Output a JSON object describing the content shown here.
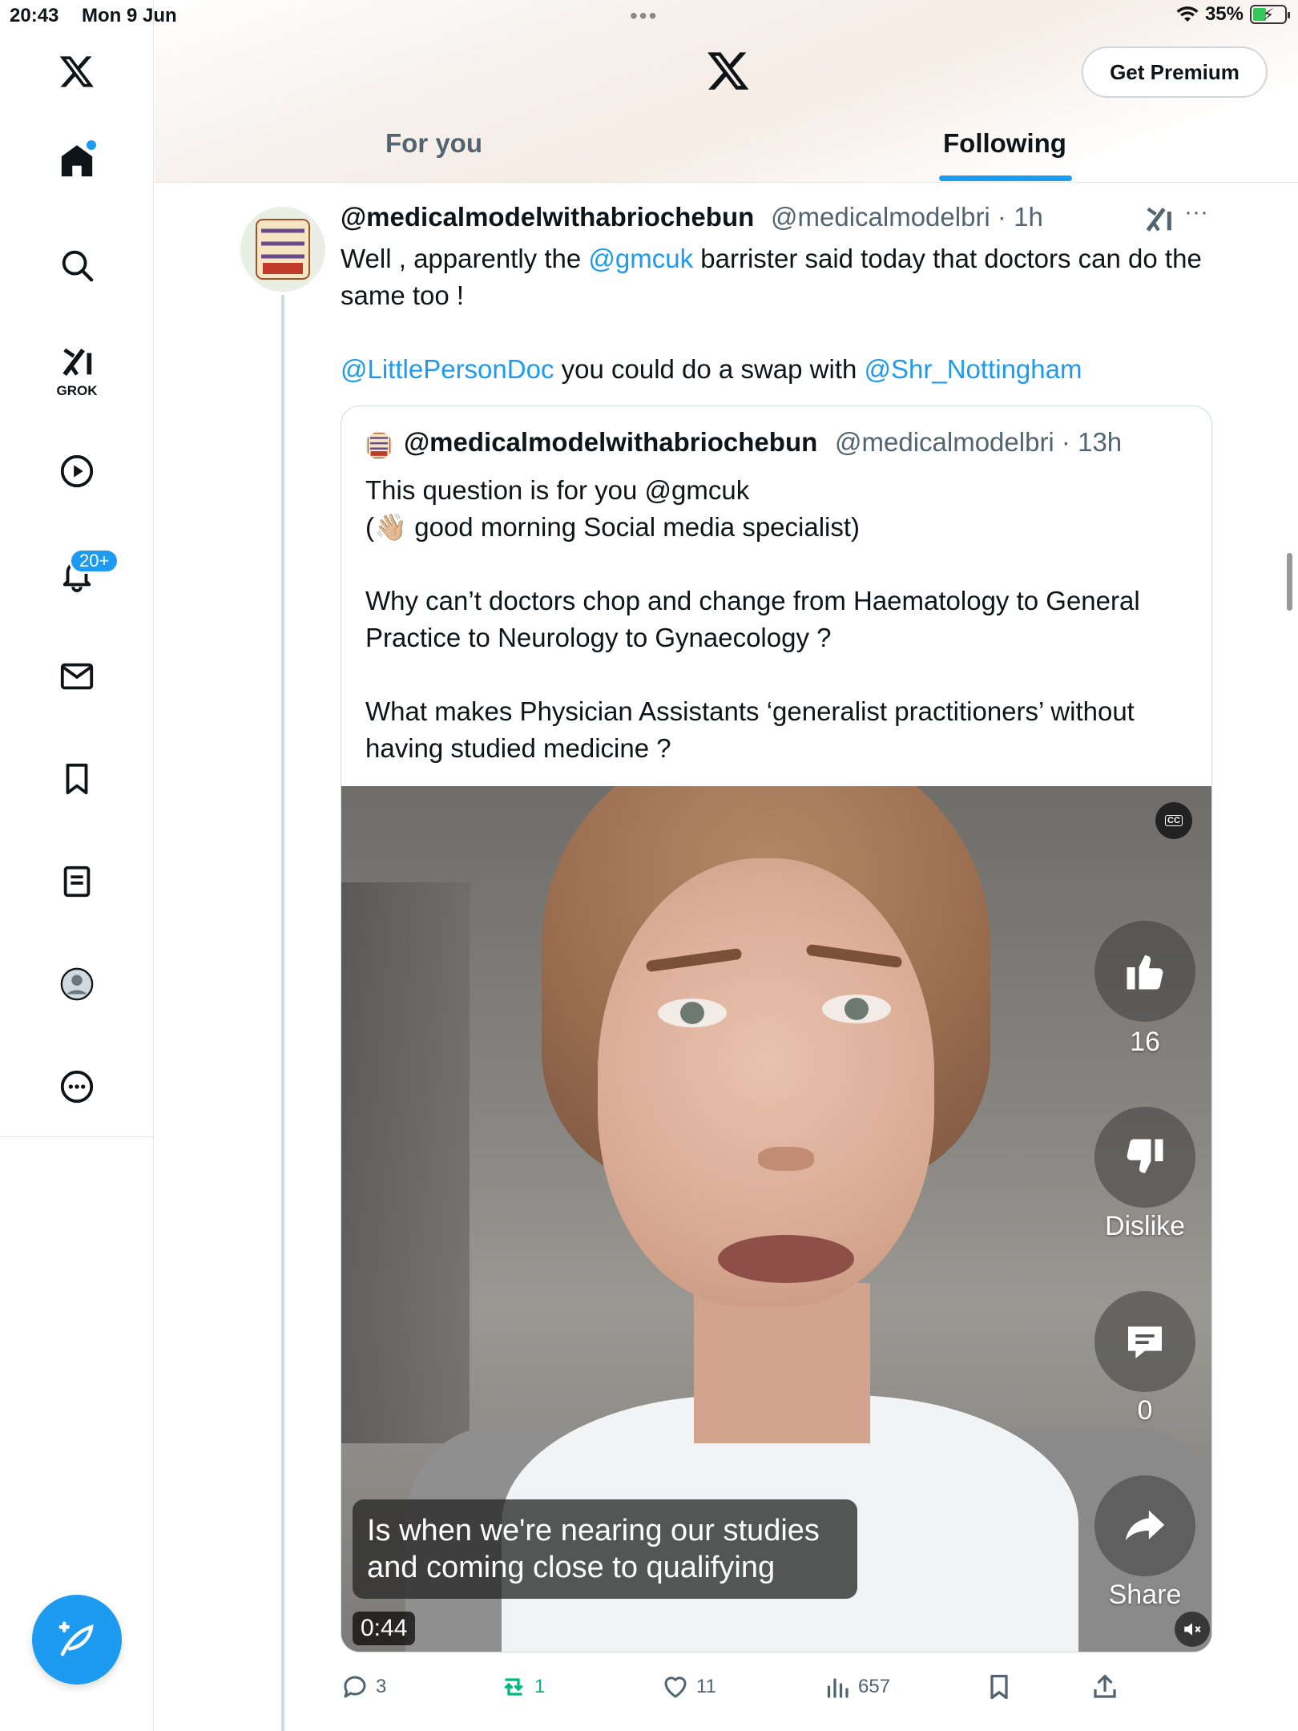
{
  "status_bar": {
    "time": "20:43",
    "date": "Mon 9 Jun",
    "battery": "35%"
  },
  "sidebar": {
    "grok_label": "GROK",
    "notifications_badge": "20+"
  },
  "header": {
    "premium_button": "Get Premium",
    "tabs": [
      {
        "label": "For you",
        "active": false
      },
      {
        "label": "Following",
        "active": true
      }
    ]
  },
  "tweet": {
    "author_name": "@medicalmodelwithabriochebun",
    "author_handle": "@medicalmodelbri",
    "time": "1h",
    "body": {
      "l1_pre": "Well , apparently the ",
      "l1_link": "@gmcuk",
      "l1_post": " barrister said today that doctors can do the same too !",
      "l2_link1": "@LittlePersonDoc",
      "l2_mid": " you could do a swap with ",
      "l2_link2": "@Shr_Nottingham"
    },
    "quote": {
      "author_name": "@medicalmodelwithabriochebun",
      "author_handle": "@medicalmodelbri",
      "time": "13h",
      "lines": {
        "p1a": "This question is for you @gmcuk",
        "p1b": "(👋🏼 good morning Social media specialist)",
        "p2": "Why can’t doctors chop and change from Haematology to General Practice to Neurology to Gynaecology ?",
        "p3": "What makes Physician Assistants ‘generalist practitioners’ without having studied medicine ?"
      },
      "video": {
        "like_count": "16",
        "dislike_label": "Dislike",
        "comment_count": "0",
        "share_label": "Share",
        "caption": "Is when we're nearing our studies and coming close to qualifying",
        "duration": "0:44"
      }
    },
    "stats": {
      "replies": "3",
      "reposts": "1",
      "likes": "11",
      "views": "657"
    }
  },
  "colors": {
    "accent": "#1d9bf0",
    "repost": "#00ba7c",
    "muted": "#536471"
  }
}
